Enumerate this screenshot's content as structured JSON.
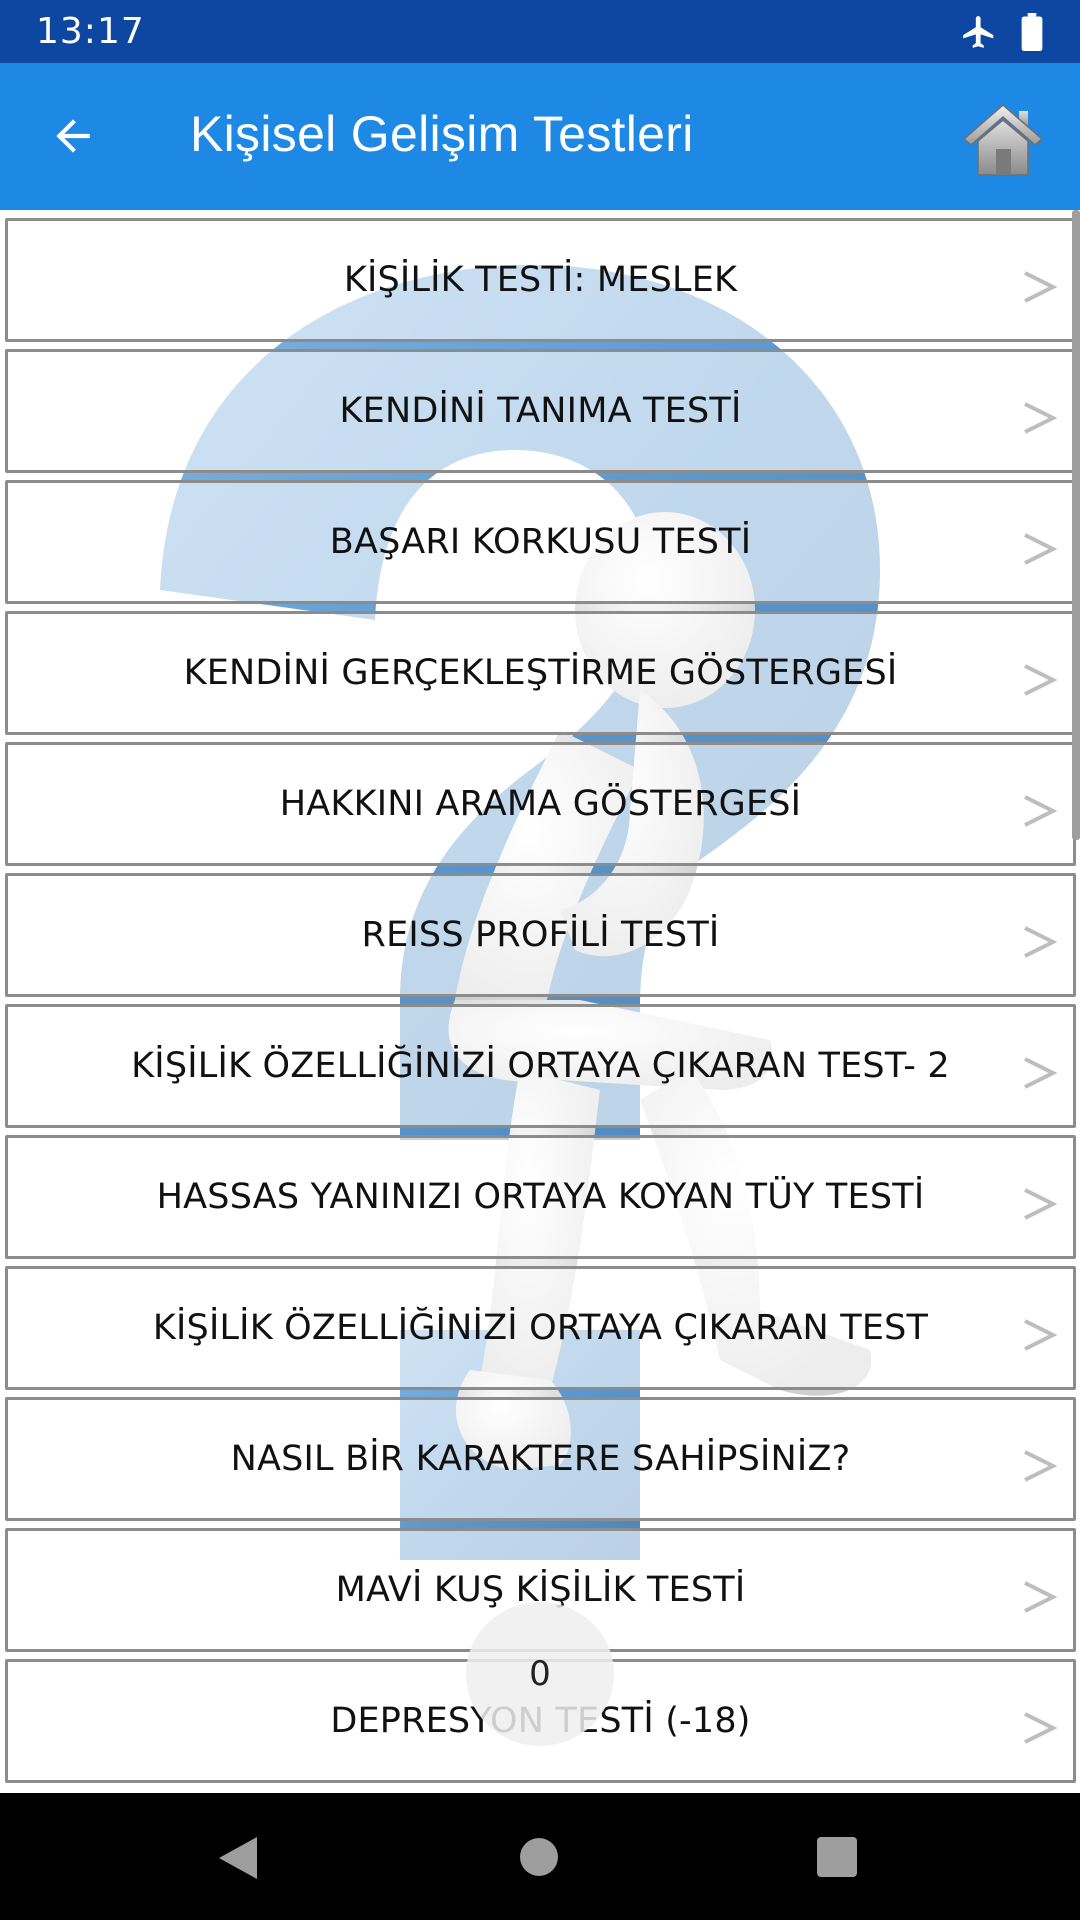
{
  "status_bar": {
    "time": "13:17",
    "icons": [
      "airplane-icon",
      "battery-icon"
    ]
  },
  "app_bar": {
    "title": "Kişisel Gelişim Testleri",
    "back_icon": "arrow-left-icon",
    "home_icon": "home-icon"
  },
  "tests": [
    {
      "label": "KİŞİLİK TESTİ: MESLEK"
    },
    {
      "label": "KENDİNİ TANIMA TESTİ"
    },
    {
      "label": "BAŞARI KORKUSU TESTİ"
    },
    {
      "label": "KENDİNİ GERÇEKLEŞTİRME GÖSTERGESİ"
    },
    {
      "label": "HAKKINI ARAMA GÖSTERGESİ"
    },
    {
      "label": "REISS PROFİLİ TESTİ"
    },
    {
      "label": "KİŞİLİK ÖZELLİĞİNİZİ ORTAYA ÇIKARAN TEST- 2"
    },
    {
      "label": "HASSAS YANINIZI ORTAYA KOYAN TÜY TESTİ"
    },
    {
      "label": "KİŞİLİK ÖZELLİĞİNİZİ ORTAYA ÇIKARAN TEST"
    },
    {
      "label": "NASIL BİR KARAKTERE SAHİPSİNİZ?"
    },
    {
      "label": "MAVİ KUŞ KİŞİLİK TESTİ"
    },
    {
      "label": "DEPRESYON TESTİ (-18)"
    }
  ],
  "counter": {
    "value": "0"
  },
  "colors": {
    "status_bar": "#0d47a1",
    "app_bar": "#1e88e5",
    "question_mark": "#3d85c6"
  },
  "nav_bar": {
    "icons": [
      "nav-back-icon",
      "nav-home-icon",
      "nav-recents-icon"
    ]
  }
}
